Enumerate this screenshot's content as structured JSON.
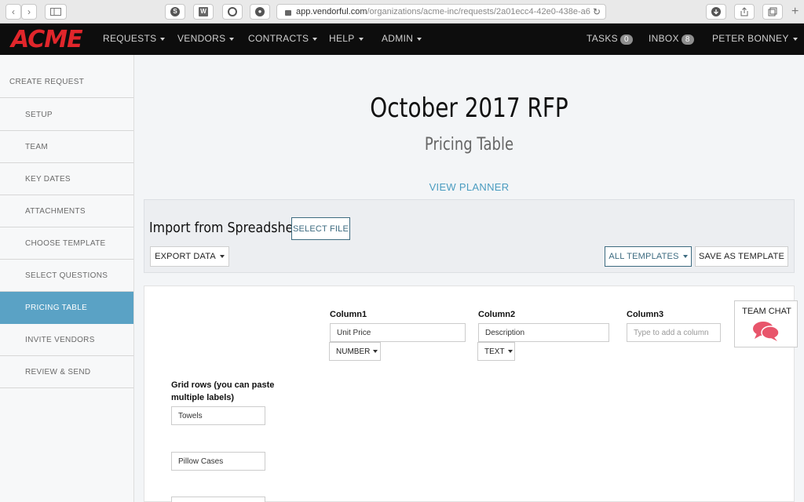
{
  "browser": {
    "url_host": "app.vendorful.com",
    "url_path": "/organizations/acme-inc/requests/2a01ecc4-42e0-438e-a6"
  },
  "nav": {
    "logo": "ACME",
    "items": [
      "REQUESTS",
      "VENDORS",
      "CONTRACTS",
      "HELP",
      "ADMIN"
    ],
    "tasks_label": "TASKS",
    "tasks_count": "0",
    "inbox_label": "INBOX",
    "inbox_count": "8",
    "user": "PETER BONNEY"
  },
  "sidebar": {
    "items": [
      "CREATE REQUEST",
      "SETUP",
      "TEAM",
      "KEY DATES",
      "ATTACHMENTS",
      "CHOOSE TEMPLATE",
      "SELECT QUESTIONS",
      "PRICING TABLE",
      "INVITE VENDORS",
      "REVIEW & SEND"
    ],
    "active": "PRICING TABLE"
  },
  "header": {
    "title": "October 2017 RFP",
    "subtitle": "Pricing Table",
    "view_planner": "VIEW PLANNER"
  },
  "import": {
    "label": "Import from Spreadsheet:",
    "select_file": "SELECT FILE",
    "export_data": "EXPORT DATA",
    "all_templates": "ALL TEMPLATES",
    "save_as_template": "SAVE AS TEMPLATE"
  },
  "columns": [
    {
      "label": "Column1",
      "value": "Unit Price",
      "type": "NUMBER"
    },
    {
      "label": "Column2",
      "value": "Description",
      "type": "TEXT"
    },
    {
      "label": "Column3",
      "placeholder": "Type to add a column"
    }
  ],
  "grid": {
    "label": "Grid rows (you can paste multiple labels)",
    "rows": [
      "Towels",
      "Pillow Cases"
    ]
  },
  "team_chat": {
    "label": "TEAM CHAT"
  }
}
